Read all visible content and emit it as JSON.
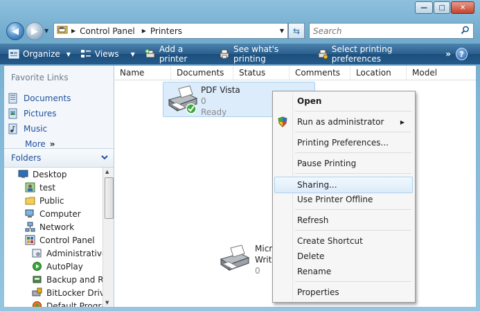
{
  "window": {
    "controls": {
      "minimize": "—",
      "maximize": "□",
      "close": "✕"
    }
  },
  "address": {
    "back_icon": "back-arrow-icon",
    "forward_icon": "forward-arrow-icon",
    "segments": [
      "Control Panel",
      "Printers"
    ]
  },
  "search": {
    "placeholder": "Search"
  },
  "toolbar": {
    "organize": "Organize",
    "views": "Views",
    "add_printer": "Add a printer",
    "see_printing": "See what's printing",
    "select_prefs": "Select printing preferences",
    "more": "»"
  },
  "favorites": {
    "title": "Favorite Links",
    "items": [
      {
        "label": "Documents",
        "icon": "documents-icon"
      },
      {
        "label": "Pictures",
        "icon": "pictures-icon"
      },
      {
        "label": "Music",
        "icon": "music-icon"
      }
    ],
    "more": "More",
    "more_chevron": "»"
  },
  "folders": {
    "title": "Folders",
    "tree": [
      {
        "label": "Desktop",
        "indent": 0,
        "icon": "desktop-icon"
      },
      {
        "label": "test",
        "indent": 1,
        "icon": "user-folder-icon"
      },
      {
        "label": "Public",
        "indent": 1,
        "icon": "folder-icon"
      },
      {
        "label": "Computer",
        "indent": 1,
        "icon": "computer-icon"
      },
      {
        "label": "Network",
        "indent": 1,
        "icon": "network-icon"
      },
      {
        "label": "Control Panel",
        "indent": 1,
        "icon": "control-panel-icon"
      },
      {
        "label": "Administrative",
        "indent": 2,
        "icon": "admin-tools-icon"
      },
      {
        "label": "AutoPlay",
        "indent": 2,
        "icon": "autoplay-icon"
      },
      {
        "label": "Backup and Re",
        "indent": 2,
        "icon": "backup-icon"
      },
      {
        "label": "BitLocker Drive",
        "indent": 2,
        "icon": "bitlocker-icon"
      },
      {
        "label": "Default Progra",
        "indent": 2,
        "icon": "default-programs-icon"
      }
    ]
  },
  "columns": [
    "Name",
    "Documents",
    "Status",
    "Comments",
    "Location",
    "Model"
  ],
  "printers": [
    {
      "name": "PDF Vista",
      "docs": "0",
      "status": "Ready"
    },
    {
      "name": "Micr",
      "name2": "Write",
      "docs": "0"
    }
  ],
  "context_menu": {
    "open": "Open",
    "run_as_admin": "Run as administrator",
    "printing_prefs": "Printing Preferences...",
    "pause": "Pause Printing",
    "sharing": "Sharing...",
    "offline": "Use Printer Offline",
    "refresh": "Refresh",
    "shortcut": "Create Shortcut",
    "delete": "Delete",
    "rename": "Rename",
    "properties": "Properties",
    "highlighted": "Sharing..."
  }
}
